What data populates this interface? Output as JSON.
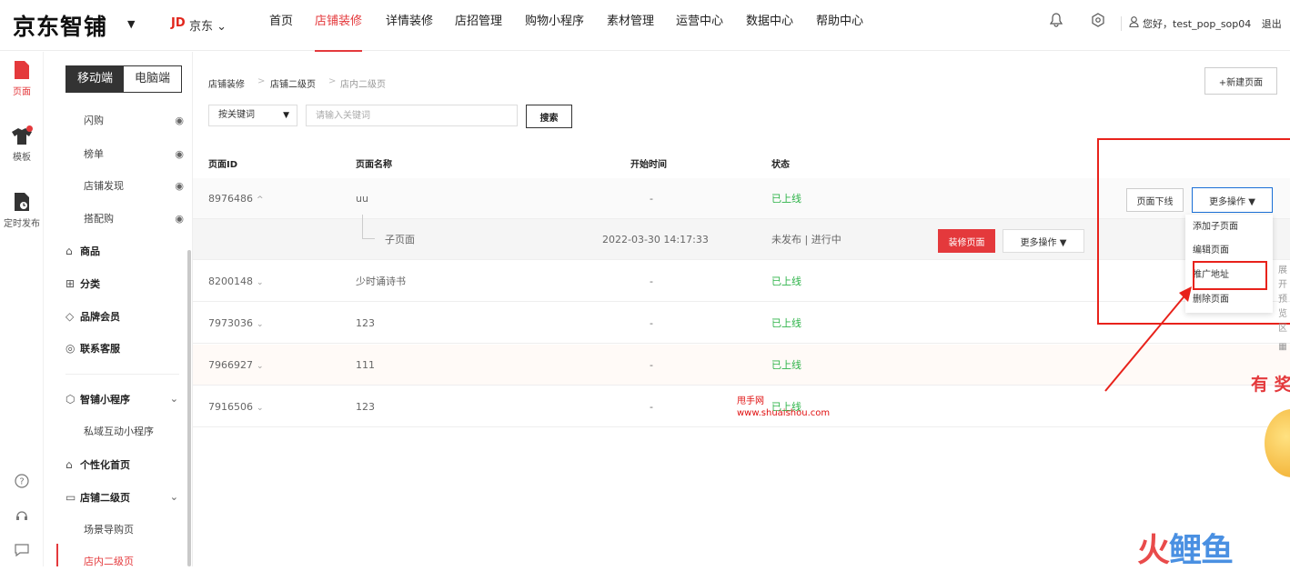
{
  "header": {
    "logo": "京东智铺",
    "logo_caret": "▼",
    "jd_brand": "JD",
    "jd_text": "京东 ⌄",
    "nav": [
      "首页",
      "店铺装修",
      "详情装修",
      "店招管理",
      "购物小程序",
      "素材管理",
      "运营中心",
      "数据中心",
      "帮助中心"
    ],
    "active_nav": "店铺装修",
    "bell_icon": "🔔",
    "settings_icon": "⚙",
    "user_icon": "person-icon",
    "greeting": "您好，test_pop_sop04",
    "logout": "退出"
  },
  "rail": {
    "items": [
      {
        "label": "页面",
        "icon": "page-icon"
      },
      {
        "label": "模板",
        "icon": "shirt-icon"
      },
      {
        "label": "定时发布",
        "icon": "scheduled-file-icon"
      }
    ],
    "bottom_icons": [
      "help-icon",
      "support-icon",
      "chat-icon"
    ]
  },
  "menu": {
    "tabs": [
      "移动端",
      "电脑端"
    ],
    "items_eye": [
      "闪购",
      "榜单",
      "店铺发现",
      "搭配购"
    ],
    "items_group": [
      {
        "label": "商品",
        "icon": "bag-icon"
      },
      {
        "label": "分类",
        "icon": "grid-icon"
      },
      {
        "label": "品牌会员",
        "icon": "diamond-icon"
      },
      {
        "label": "联系客服",
        "icon": "chat-icon"
      }
    ],
    "mini": {
      "label": "智铺小程序",
      "sub": "私域互动小程序"
    },
    "personal": "个性化首页",
    "second": {
      "label": "店铺二级页",
      "sub1": "场景导购页",
      "sub2": "店内二级页"
    }
  },
  "breadcrumb": [
    "店铺装修",
    "店铺二级页",
    "店内二级页"
  ],
  "breadcrumb_sep": ">",
  "search": {
    "select_label": "按关键词",
    "placeholder": "请输入关键词",
    "button": "搜索"
  },
  "new_page": "+新建页面",
  "table": {
    "headers": [
      "页面ID",
      "页面名称",
      "开始时间",
      "状态"
    ],
    "rows": [
      {
        "id": "8976486",
        "chev": "^",
        "name": "uu",
        "time": "-",
        "status": "已上线"
      },
      {
        "id": "",
        "chev": "",
        "name": "子页面",
        "time": "2022-03-30 14:17:33",
        "status": "未发布 | 进行中"
      },
      {
        "id": "8200148",
        "chev": "⌄",
        "name": "少时诵诗书",
        "time": "-",
        "status": "已上线"
      },
      {
        "id": "7973036",
        "chev": "⌄",
        "name": "123",
        "time": "-",
        "status": "已上线"
      },
      {
        "id": "7966927",
        "chev": "⌄",
        "name": "111",
        "time": "-",
        "status": "已上线"
      },
      {
        "id": "7916506",
        "chev": "⌄",
        "name": "123",
        "time": "-",
        "status": "已上线"
      }
    ]
  },
  "actions": {
    "decorate": "装修页面",
    "more": "更多操作 ▼",
    "offline": "页面下线",
    "more2": "更多操作 ▼"
  },
  "dropdown": [
    "添加子页面",
    "编辑页面",
    "推广地址",
    "删除页面"
  ],
  "side_strip": [
    "展",
    "开",
    "预",
    "览",
    "区"
  ],
  "watermark": {
    "line1": "甩手网",
    "line2": "www.shuaishou.com"
  },
  "prize": "有 奖",
  "brand_logo": {
    "a": "火",
    "b": "鲤",
    "c": "鱼"
  },
  "colors": {
    "accent": "#e4393c",
    "online": "#2fb44a",
    "annotation": "#e8221b",
    "blue_focus": "#1a6fd6"
  }
}
